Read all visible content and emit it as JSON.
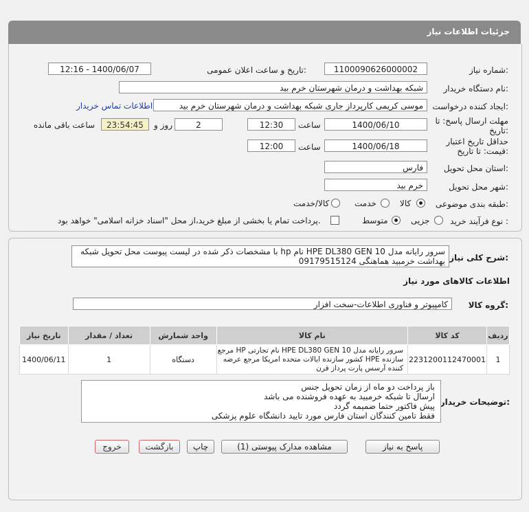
{
  "header": {
    "title": "جزئیات اطلاعات نیاز"
  },
  "fields": {
    "need_number_label": "شماره نیاز:",
    "need_number": "1100090626000002",
    "announce_label": "تاریخ و ساعت اعلان عمومی:",
    "announce_value": "1400/06/07 - 12:16",
    "buyer_label": "نام دستگاه خریدار:",
    "buyer_value": "شبکه بهداشت و درمان شهرستان خرم بید",
    "creator_label": "ایجاد کننده درخواست:",
    "creator_value": "موسی کریمی کارپرداز جاری شبکه بهداشت و درمان شهرستان خرم بید",
    "contact_link": "اطلاعات تماس خریدار",
    "reply_label_1": "مهلت ارسال پاسخ: تا",
    "reply_label_2": "تاریخ:",
    "reply_date": "1400/06/10",
    "time_word": "ساعت",
    "reply_time": "12:30",
    "days_value": "2",
    "days_word": "روز و",
    "remaining_time": "23:54:45",
    "remaining_word": "ساعت باقی مانده",
    "valid_label_1": "حداقل تاریخ اعتبار",
    "valid_label_2": "قیمت: تا تاریخ:",
    "valid_date": "1400/06/18",
    "valid_time": "12:00",
    "province_label": "استان محل تحویل:",
    "province_value": "فارس",
    "city_label": "شهر محل تحویل:",
    "city_value": "خرم بید",
    "category_label": "طبقه بندی موضوعی:",
    "category_options": [
      "کالا",
      "خدمت",
      "کالا/خدمت"
    ],
    "category_selected": "کالا",
    "process_label": "نوع فرآیند خرید :",
    "process_options": [
      "جزیی",
      "متوسط"
    ],
    "process_selected": "متوسط",
    "payment_text": "پرداخت تمام یا بخشی از مبلغ خرید،از محل \"اسناد خزانه اسلامی\" خواهد بود."
  },
  "description": {
    "label": "شرح کلی نیاز:",
    "line1": "سرور رایانه مدل HPE DL380 GEN 10 نام hp با مشخصات ذکر شده در لیست پیوست محل تحویل شبکه",
    "line2": "بهداشت خرمبید هماهنگی 09179515124"
  },
  "goods_section": {
    "title": "اطلاعات کالاهای مورد نیاز"
  },
  "goods_group": {
    "label": "گروه کالا:",
    "value": "کامپیوتر و فناوری اطلاعات-سخت افزار"
  },
  "table": {
    "headers": [
      "ردیف",
      "کد کالا",
      "نام کالا",
      "واحد شمارش",
      "تعداد / مقدار",
      "تاریخ نیاز"
    ],
    "rows": [
      {
        "row": "1",
        "code": "2231200112470001",
        "name_lines": [
          "سرور رایانه مدل HPE DL380 GEN 10 نام تجارتی HP مرجع",
          "سازنده HPE کشور سازنده ایالات متحده امریکا مرجع عرضه",
          "کننده آرسس پارت پرداز قرن"
        ],
        "unit": "دستگاه",
        "qty": "1",
        "date": "1400/06/11"
      }
    ]
  },
  "buyer_notes": {
    "label": "توضیحات خریدار:",
    "lines": [
      "باز پرداخت دو ماه از زمان تحویل جنس",
      "ارسال تا شبکه خرمبید به عهده فروشنده می باشد",
      "پیش فاکتور حتما ضمیمه گردد",
      "فقط تامین کنندگان استان فارس مورد تایید دانشگاه علوم پزشکی"
    ]
  },
  "buttons": {
    "reply": "پاسخ به نیاز",
    "attachments": "مشاهده مدارک پیوستی (1)",
    "print": "چاپ",
    "back": "بازگشت",
    "exit": "خروج"
  },
  "colors": {
    "title_bar": "#8a8a8a",
    "timer_bg": "#f5f0c8",
    "link": "#1a3fb0"
  }
}
